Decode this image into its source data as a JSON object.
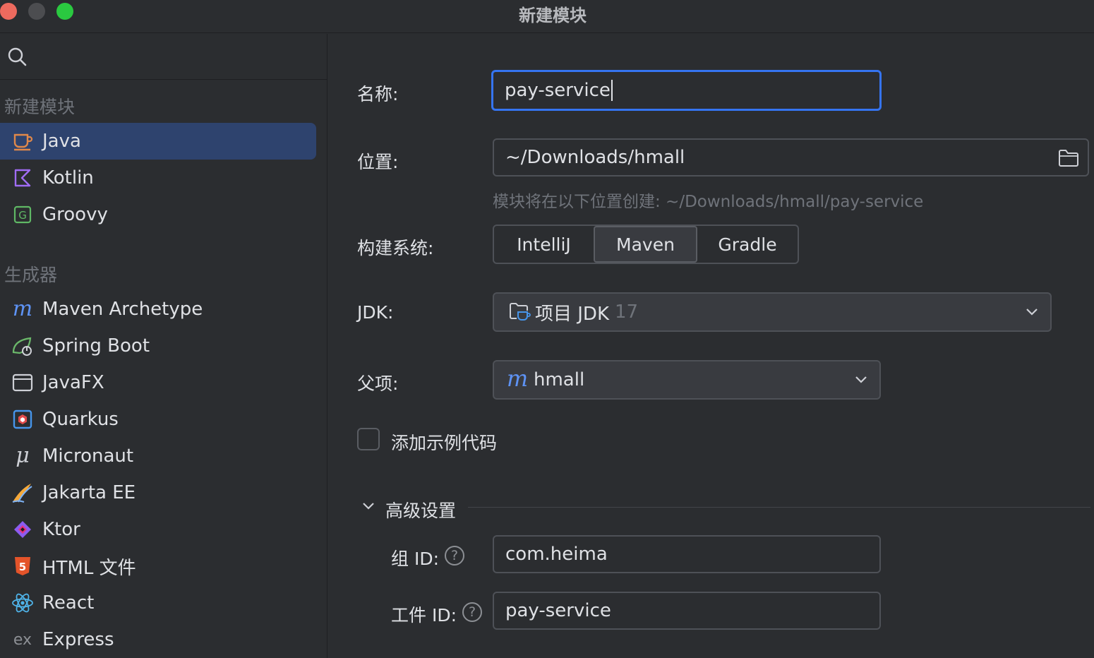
{
  "window": {
    "title": "新建模块"
  },
  "sidebar": {
    "section_new": "新建模块",
    "new_items": [
      {
        "label": "Java",
        "icon": "java-cup-icon",
        "selected": true
      },
      {
        "label": "Kotlin",
        "icon": "kotlin-icon"
      },
      {
        "label": "Groovy",
        "icon": "groovy-icon"
      }
    ],
    "section_generators": "生成器",
    "generator_items": [
      {
        "label": "Maven Archetype",
        "icon": "maven-icon"
      },
      {
        "label": "Spring Boot",
        "icon": "spring-boot-icon"
      },
      {
        "label": "JavaFX",
        "icon": "javafx-window-icon"
      },
      {
        "label": "Quarkus",
        "icon": "quarkus-icon"
      },
      {
        "label": "Micronaut",
        "icon": "micronaut-icon"
      },
      {
        "label": "Jakarta EE",
        "icon": "jakarta-ee-icon"
      },
      {
        "label": "Ktor",
        "icon": "ktor-icon"
      },
      {
        "label": "HTML 文件",
        "icon": "html5-icon"
      },
      {
        "label": "React",
        "icon": "react-icon"
      },
      {
        "label": "Express",
        "icon": "express-icon"
      }
    ]
  },
  "form": {
    "name_label": "名称:",
    "name_value": "pay-service",
    "location_label": "位置:",
    "location_value": "~/Downloads/hmall",
    "location_hint": "模块将在以下位置创建: ~/Downloads/hmall/pay-service",
    "build_label": "构建系统:",
    "build_options": [
      "IntelliJ",
      "Maven",
      "Gradle"
    ],
    "build_selected": "Maven",
    "jdk_label": "JDK:",
    "jdk_value": "项目 JDK",
    "jdk_version": "17",
    "parent_label": "父项:",
    "parent_value": "hmall",
    "sample_code_label": "添加示例代码",
    "sample_code_checked": false,
    "advanced_label": "高级设置",
    "group_label": "组 ID:",
    "group_value": "com.heima",
    "artifact_label": "工件 ID:",
    "artifact_value": "pay-service",
    "help_glyph": "?"
  },
  "colors": {
    "accent": "#3574f0",
    "selection": "#2e436e",
    "background": "#2b2d30"
  }
}
